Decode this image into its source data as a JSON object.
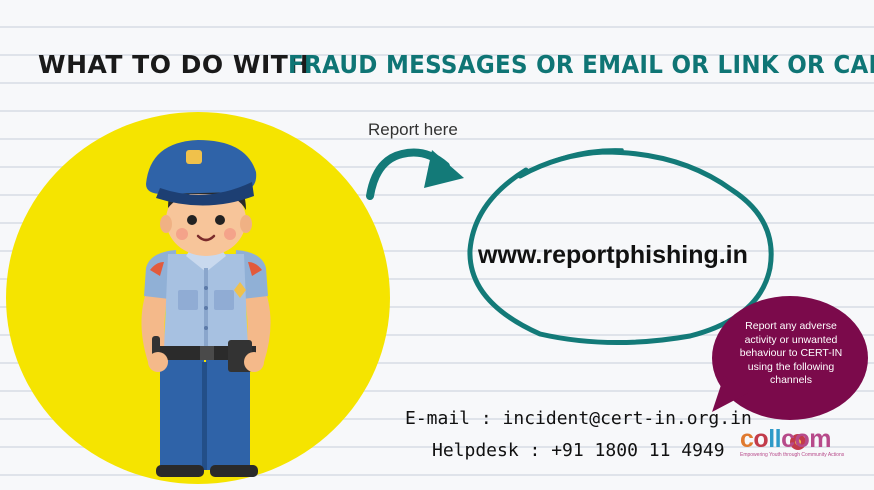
{
  "title": {
    "part1": "WHAT TO DO WITH",
    "part2": "FRAUD MESSAGES OR EMAIL OR LINK OR CALL"
  },
  "report_label": "Report here",
  "website": "www.reportphishing.in",
  "bubble_text": "Report any adverse activity or unwanted behaviour to CERT-IN using the following channels",
  "contact": {
    "email_line": "E-mail : incident@cert-in.org.in",
    "helpdesk_line": "Helpdesk : +91 1800 11 4949"
  },
  "logo": {
    "name": "collcom",
    "tagline": "Empowering Youth through Community Actions"
  },
  "icons": [
    "police-officer-illustration",
    "curved-arrow-icon"
  ],
  "colors": {
    "accent_teal": "#0f7575",
    "yellow_circle": "#f5e400",
    "bubble_purple": "#7b0a4b",
    "uniform_blue": "#2f63a8"
  }
}
